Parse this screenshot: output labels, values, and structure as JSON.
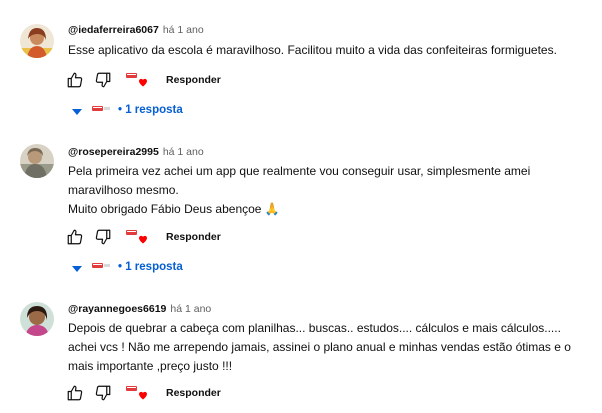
{
  "comments": [
    {
      "author": "@iedaferreira6067",
      "time": "há 1 ano",
      "lines": [
        "Esse aplicativo da escola é maravilhoso. Facilitou muito a vida das confeiteiras formiguetes."
      ],
      "reply_label": "Responder",
      "replies_label": "• 1 resposta"
    },
    {
      "author": "@rosepereira2995",
      "time": "há 1 ano",
      "lines": [
        "Pela primeira vez achei um app que realmente vou conseguir usar, simplesmente amei",
        "maravilhoso mesmo.",
        "Muito obrigado Fábio Deus abençoe 🙏"
      ],
      "reply_label": "Responder",
      "replies_label": "• 1 resposta"
    },
    {
      "author": "@rayannegoes6619",
      "time": "há 1 ano",
      "lines": [
        "Depois de quebrar a cabeça com planilhas... buscas.. estudos.... cálculos e mais cálculos.....",
        "achei vcs ! Não me arrependo jamais, assinei o plano anual e minhas vendas estão ótimas e o",
        "mais importante ,preço justo !!!"
      ],
      "reply_label": "Responder"
    }
  ],
  "icons": {
    "like": "thumb-up-icon",
    "dislike": "thumb-down-icon",
    "heart": "creator-heart-icon",
    "expand": "caret-down-icon"
  },
  "colors": {
    "link": "#065fd4",
    "heart": "#ff0000",
    "meta": "#606060"
  }
}
